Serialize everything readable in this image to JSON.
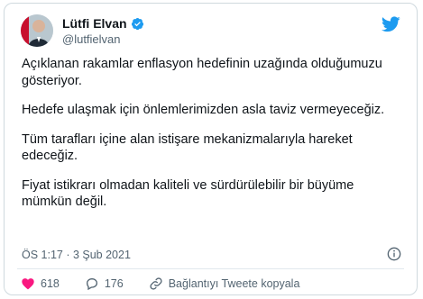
{
  "author": {
    "name": "Lütfi Elvan",
    "handle": "@lutfielvan",
    "verified": true
  },
  "tweet": {
    "paragraphs": [
      "Açıklanan rakamlar enflasyon hedefinin uzağında olduğumuzu gösteriyor.",
      "Hedefe ulaşmak için önlemlerimizden asla taviz vermeyeceğiz.",
      "Tüm tarafları içine alan istişare mekanizmalarıyla hareket edeceğiz.",
      "Fiyat istikrarı olmadan kaliteli ve sürdürülebilir bir büyüme mümkün değil."
    ],
    "timestamp": "ÖS 1:17 · 3 Şub 2021"
  },
  "actions": {
    "likes": "618",
    "replies": "176",
    "copy_link": "Bağlantıyı Tweete kopyala"
  },
  "colors": {
    "twitter_blue": "#1d9bf0",
    "like_red": "#f91880",
    "muted": "#536471"
  },
  "icons": [
    "twitter-bird-icon",
    "verified-badge-icon",
    "info-icon",
    "heart-icon",
    "reply-icon",
    "link-icon"
  ]
}
